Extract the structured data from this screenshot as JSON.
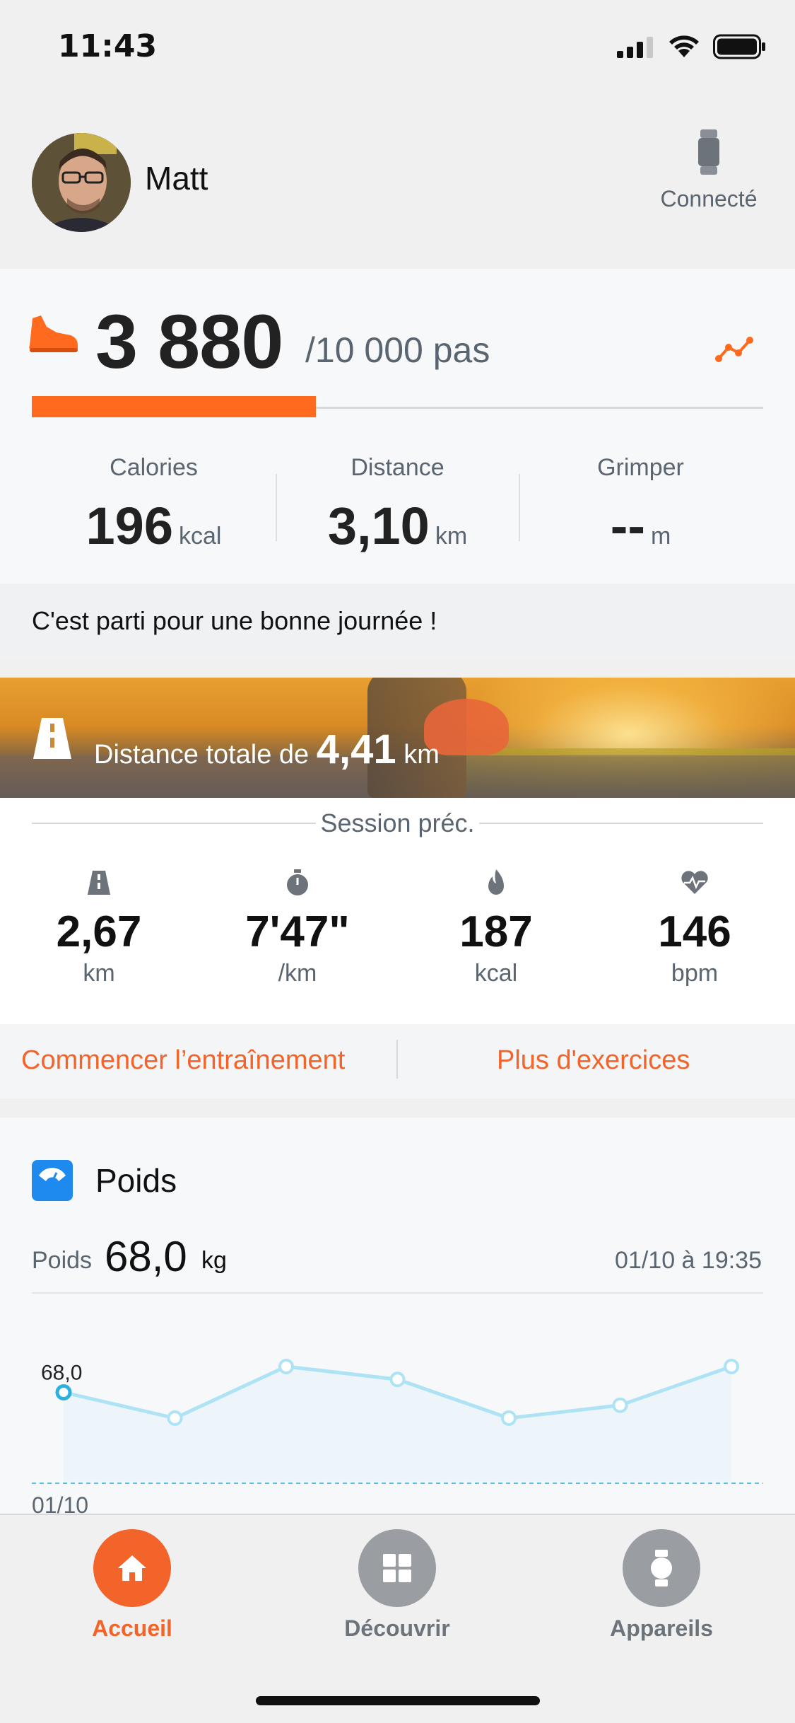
{
  "status_bar": {
    "time": "11:43"
  },
  "profile": {
    "name": "Matt",
    "device_status": "Connecté"
  },
  "steps": {
    "value": "3 880",
    "goal_text": "/10 000 pas",
    "progress_fraction": 0.388,
    "accent_color": "#ff6a1e"
  },
  "metrics": [
    {
      "label": "Calories",
      "value": "196",
      "unit": "kcal"
    },
    {
      "label": "Distance",
      "value": "3,10",
      "unit": "km"
    },
    {
      "label": "Grimper",
      "value": "--",
      "unit": "m"
    }
  ],
  "motivation": "C'est parti pour une bonne journée !",
  "banner": {
    "prefix": "Distance totale de ",
    "value": "4,41",
    "unit": "km"
  },
  "session": {
    "title": "Session préc.",
    "stats": [
      {
        "icon": "road-icon",
        "value": "2,67",
        "unit": "km"
      },
      {
        "icon": "stopwatch-icon",
        "value": "7'47\"",
        "unit": "/km"
      },
      {
        "icon": "flame-icon",
        "value": "187",
        "unit": "kcal"
      },
      {
        "icon": "heart-rate-icon",
        "value": "146",
        "unit": "bpm"
      }
    ]
  },
  "actions": {
    "start_workout": "Commencer l’entraînement",
    "more_exercises": "Plus d'exercices"
  },
  "weight": {
    "title": "Poids",
    "label": "Poids",
    "value": "68,0",
    "unit": "kg",
    "timestamp": "01/10 à 19:35",
    "point_label": "68,0",
    "date_label": "01/10",
    "line_color": "#aee3f5"
  },
  "chart_data": {
    "type": "line",
    "series": [
      {
        "values": [
          68.0,
          67.6,
          68.4,
          68.2,
          67.6,
          67.8,
          68.4
        ]
      }
    ],
    "labels": [
      "68,0"
    ],
    "x": [
      "01/10"
    ]
  },
  "tabs": [
    {
      "label": "Accueil",
      "icon": "home-icon",
      "active": true
    },
    {
      "label": "Découvrir",
      "icon": "grid-icon",
      "active": false
    },
    {
      "label": "Appareils",
      "icon": "watch-icon",
      "active": false
    }
  ]
}
